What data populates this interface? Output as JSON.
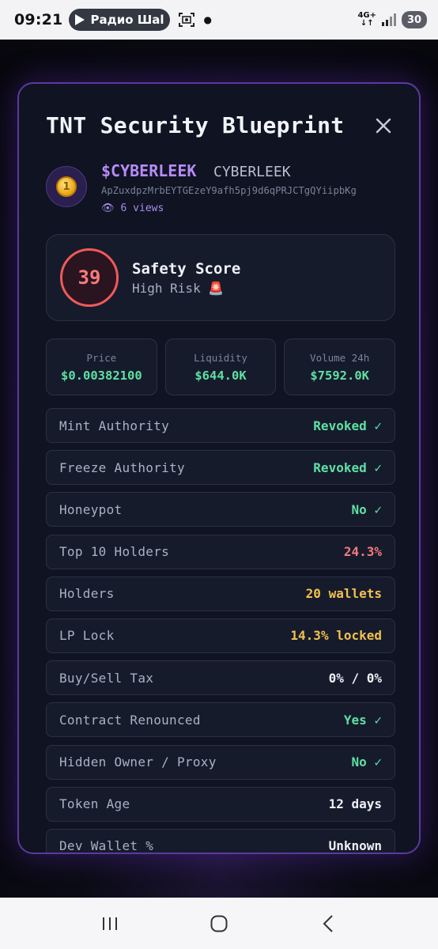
{
  "status_bar": {
    "time": "09:21",
    "media_title": "Радио Шаl",
    "network": "4G+",
    "battery": "30"
  },
  "modal": {
    "title": "TNT Security Blueprint",
    "token": {
      "symbol": "$CYBERLEEK",
      "name": "CYBERLEEK",
      "address": "ApZuxdpzMrbEYTGEzeY9afh5pj9d6qPRJCTgQYiipbKg",
      "views": "6 views",
      "avatar_glyph": "1"
    },
    "safety": {
      "score": "39",
      "title": "Safety Score",
      "risk": "High Risk 🚨",
      "ring_color": "#ef5a5a"
    },
    "stats": [
      {
        "label": "Price",
        "value": "$0.00382100"
      },
      {
        "label": "Liquidity",
        "value": "$644.0K"
      },
      {
        "label": "Volume 24h",
        "value": "$7592.0K"
      }
    ],
    "checks": [
      {
        "label": "Mint Authority",
        "value": "Revoked ✓"
      },
      {
        "label": "Freeze Authority",
        "value": "Revoked ✓"
      },
      {
        "label": "Honeypot",
        "value": "No ✓"
      },
      {
        "label": "Top 10 Holders",
        "value": "24.3%"
      },
      {
        "label": "Holders",
        "value": "20 wallets"
      },
      {
        "label": "LP Lock",
        "value": "14.3% locked"
      },
      {
        "label": "Buy/Sell Tax",
        "value": "0% / 0%"
      },
      {
        "label": "Contract Renounced",
        "value": "Yes ✓"
      },
      {
        "label": "Hidden Owner / Proxy",
        "value": "No ✓"
      },
      {
        "label": "Token Age",
        "value": "12 days"
      },
      {
        "label": "Dev Wallet %",
        "value": "Unknown"
      }
    ]
  },
  "colors": {
    "accent": "#b78cf7",
    "border_glow": "#5b3a9c",
    "good": "#5fe0a3",
    "bad": "#f47b7b",
    "warn": "#f2c14e"
  }
}
